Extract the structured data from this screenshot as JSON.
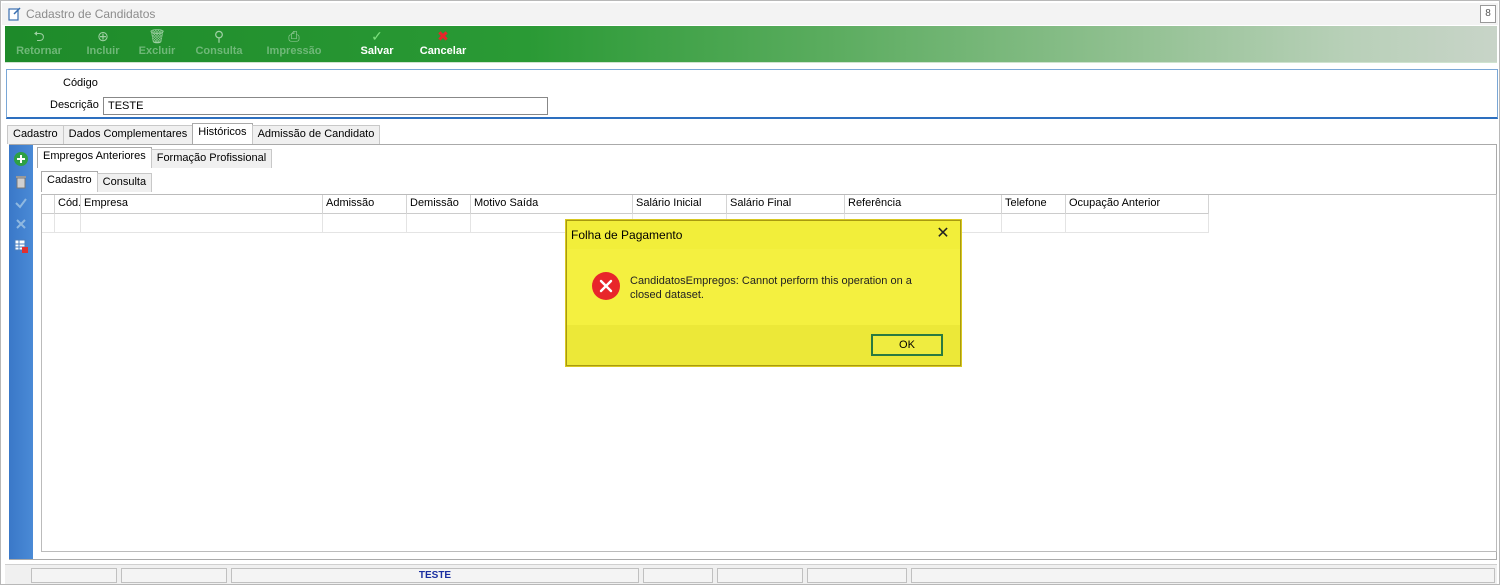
{
  "window": {
    "title": "Cadastro de Candidatos",
    "restore_glyph": "8"
  },
  "toolbar": {
    "buttons": [
      {
        "label": "Retornar",
        "icon": "return-arrow-icon",
        "glyph": "⮌",
        "state": "disabled"
      },
      {
        "label": "Incluir",
        "icon": "add-circle-icon",
        "glyph": "⊕",
        "state": "disabled"
      },
      {
        "label": "Excluir",
        "icon": "trash-icon",
        "glyph": "🗑",
        "state": "disabled"
      },
      {
        "label": "Consulta",
        "icon": "magnifier-icon",
        "glyph": "⚲",
        "state": "disabled"
      },
      {
        "label": "Impressão",
        "icon": "printer-icon",
        "glyph": "⎙",
        "state": "disabled"
      },
      {
        "label": "Salvar",
        "icon": "checkmark-icon",
        "glyph": "✓",
        "state": "enabled"
      },
      {
        "label": "Cancelar",
        "icon": "x-cancel-icon",
        "glyph": "✖",
        "state": "enabled"
      }
    ]
  },
  "form": {
    "codigo_label": "Código",
    "descricao_label": "Descrição",
    "descricao_value": "TESTE"
  },
  "tabs": {
    "main": [
      "Cadastro",
      "Dados Complementares",
      "Históricos",
      "Admissão de Candidato"
    ],
    "main_active": "Históricos",
    "sub": [
      "Empregos Anteriores",
      "Formação Profissional"
    ],
    "sub_active": "Empregos Anteriores",
    "sub2": [
      "Cadastro",
      "Consulta"
    ],
    "sub2_active": "Cadastro"
  },
  "sidebar_icons": [
    "add-green-icon",
    "delete-icon",
    "confirm-check-icon",
    "cancel-x-icon",
    "grid-delete-icon"
  ],
  "grid": {
    "columns": [
      "",
      "Cód.",
      "Empresa",
      "Admissão",
      "Demissão",
      "Motivo Saída",
      "Salário Inicial",
      "Salário Final",
      "Referência",
      "Telefone",
      "Ocupação Anterior"
    ]
  },
  "dialog": {
    "title": "Folha de Pagamento",
    "message": "CandidatosEmpregos: Cannot perform this operation on a closed dataset.",
    "ok_label": "OK",
    "icon": "error-circle-icon"
  },
  "statusbar": {
    "center_text": "TESTE"
  }
}
